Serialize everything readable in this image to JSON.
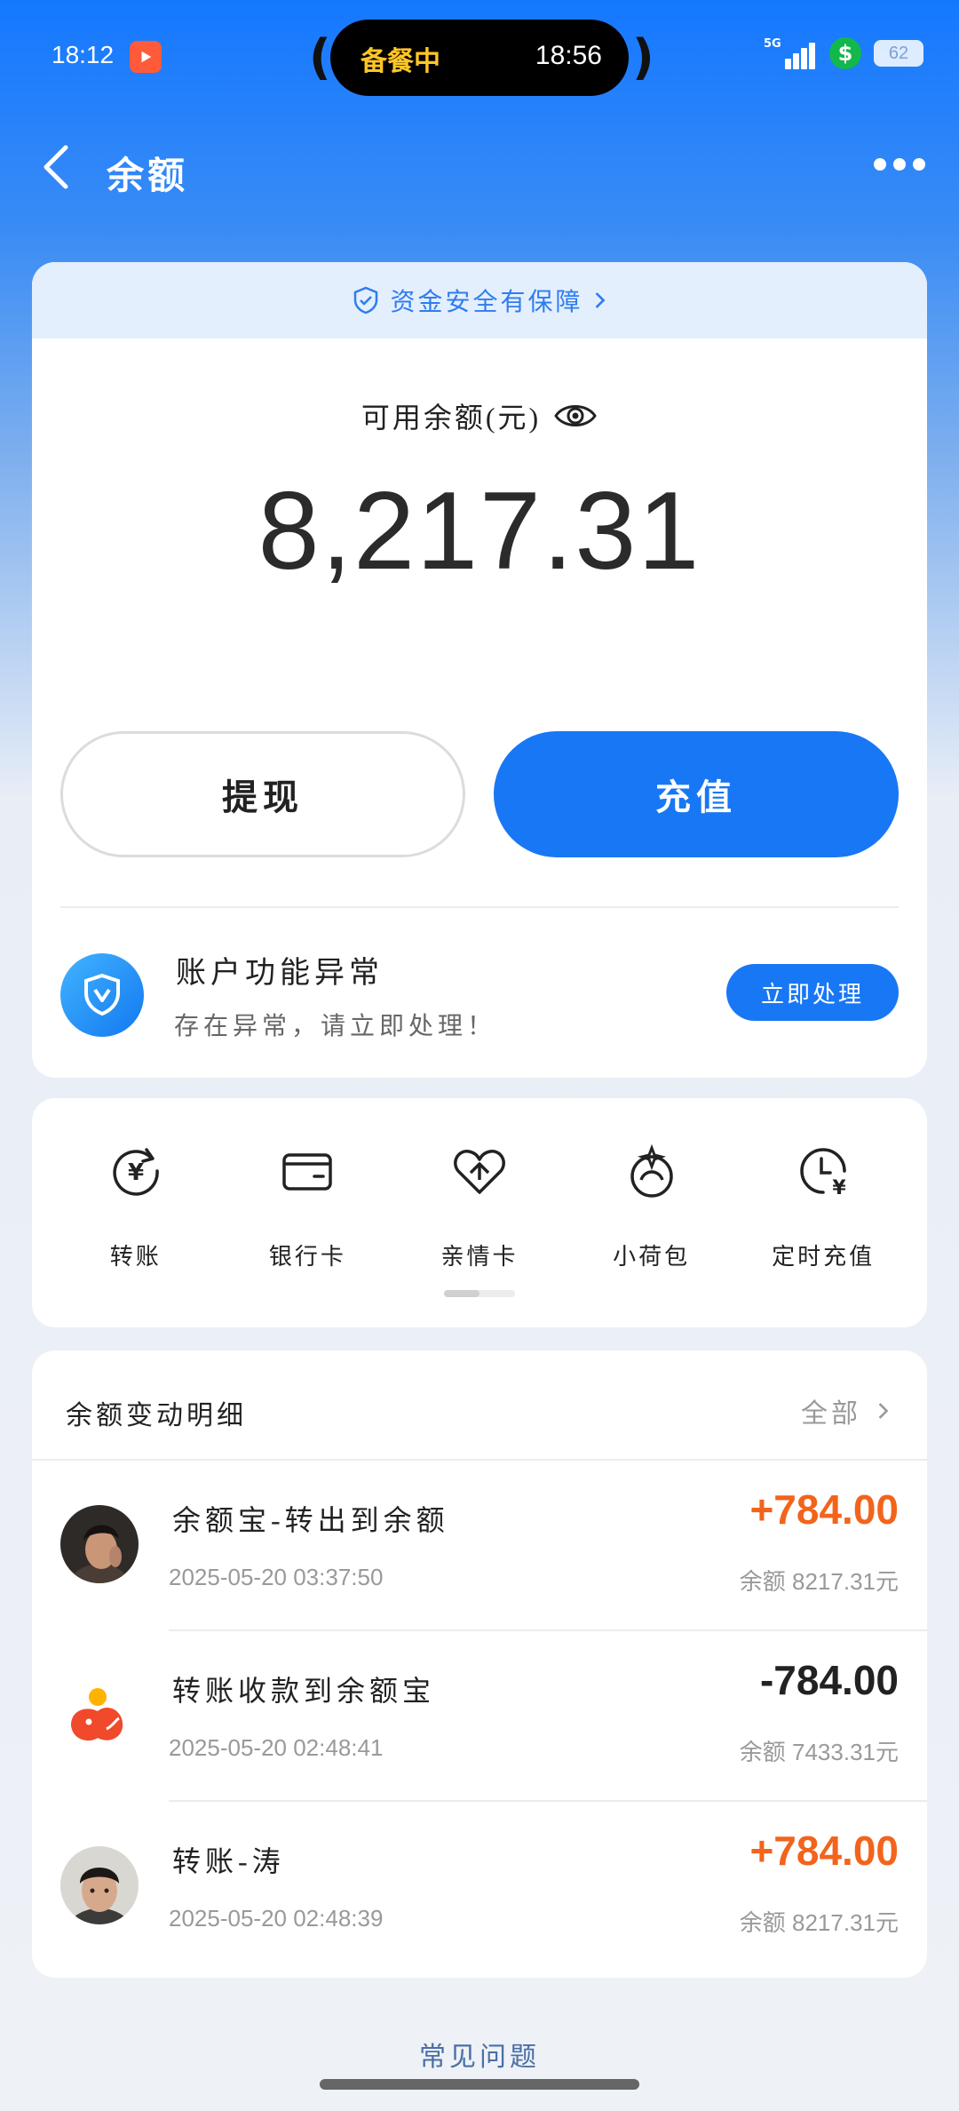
{
  "status_bar": {
    "time": "18:12",
    "island_text": "备餐中",
    "island_time": "18:56",
    "network": "5G",
    "pay_icon": "dollar",
    "battery": "62"
  },
  "nav": {
    "title": "余额"
  },
  "balance_card": {
    "safety_banner": "资金安全有保障",
    "label": "可用余额(元)",
    "amount": "8,217.31",
    "withdraw_label": "提现",
    "recharge_label": "充值",
    "alert_title": "账户功能异常",
    "alert_subtitle": "存在异常，请立即处理！",
    "alert_button": "立即处理"
  },
  "actions": [
    {
      "label": "转账",
      "icon": "transfer-icon"
    },
    {
      "label": "银行卡",
      "icon": "bank-card-icon"
    },
    {
      "label": "亲情卡",
      "icon": "family-card-icon"
    },
    {
      "label": "小荷包",
      "icon": "pouch-icon"
    },
    {
      "label": "定时充值",
      "icon": "scheduled-recharge-icon"
    }
  ],
  "transactions": {
    "header_title": "余额变动明细",
    "header_all": "全部",
    "items": [
      {
        "title": "余额宝-转出到余额",
        "time": "2025-05-20 03:37:50",
        "amount": "+784.00",
        "balance": "余额 8217.31元",
        "direction": "in"
      },
      {
        "title": "转账收款到余额宝",
        "time": "2025-05-20 02:48:41",
        "amount": "-784.00",
        "balance": "余额 7433.31元",
        "direction": "out"
      },
      {
        "title": "转账-涛",
        "time": "2025-05-20 02:48:39",
        "amount": "+784.00",
        "balance": "余额 8217.31元",
        "direction": "in"
      }
    ]
  },
  "faq": "常见问题",
  "colors": {
    "accent": "#1877f5",
    "positive": "#f2641c",
    "safety_bg": "#e4effd"
  }
}
